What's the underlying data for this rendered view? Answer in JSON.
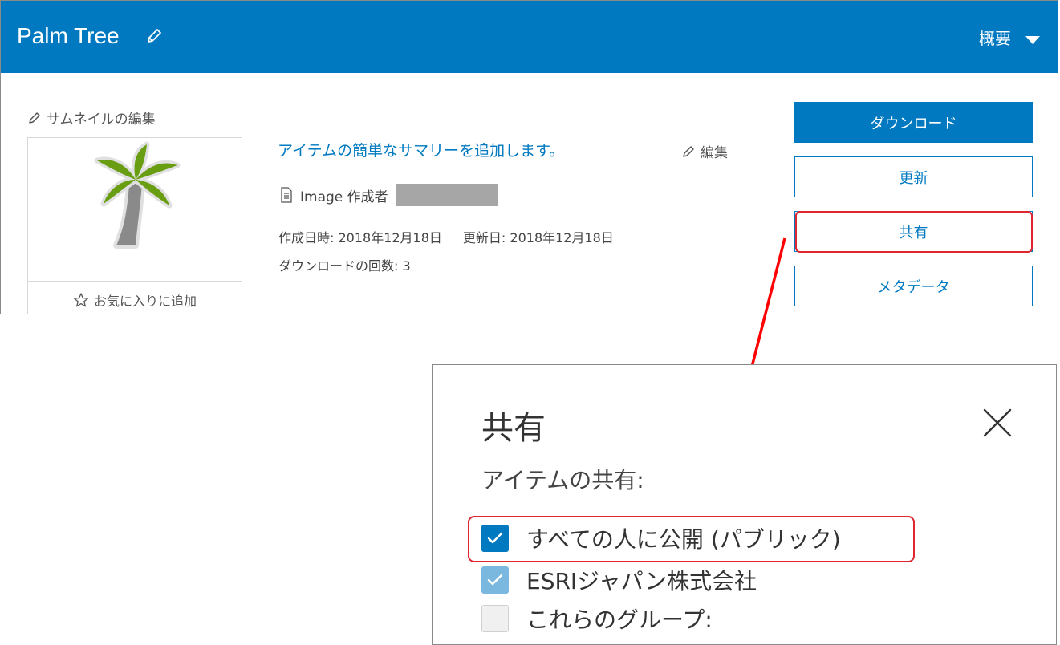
{
  "header": {
    "title": "Palm Tree",
    "menu_label": "概要"
  },
  "thumbnail": {
    "edit_label": "サムネイルの編集",
    "favorite_label": "お気に入りに追加"
  },
  "summary": {
    "link_text": "アイテムの簡単なサマリーを追加します。",
    "edit_label": "編集"
  },
  "meta": {
    "type_text": "Image 作成者",
    "created": "作成日時: 2018年12月18日",
    "updated": "更新日: 2018年12月18日",
    "downloads": "ダウンロードの回数: 3"
  },
  "actions": {
    "download": "ダウンロード",
    "update": "更新",
    "share": "共有",
    "metadata": "メタデータ"
  },
  "share_dialog": {
    "title": "共有",
    "subtitle": "アイテムの共有:",
    "options": [
      {
        "label": "すべての人に公開 (パブリック)",
        "checked": true
      },
      {
        "label": "ESRIジャパン株式会社",
        "checked": true
      },
      {
        "label": "これらのグループ:",
        "checked": false
      }
    ]
  },
  "colors": {
    "brand": "#0079c1",
    "highlight": "#e0262f",
    "redaction": "#a6a6a6"
  }
}
